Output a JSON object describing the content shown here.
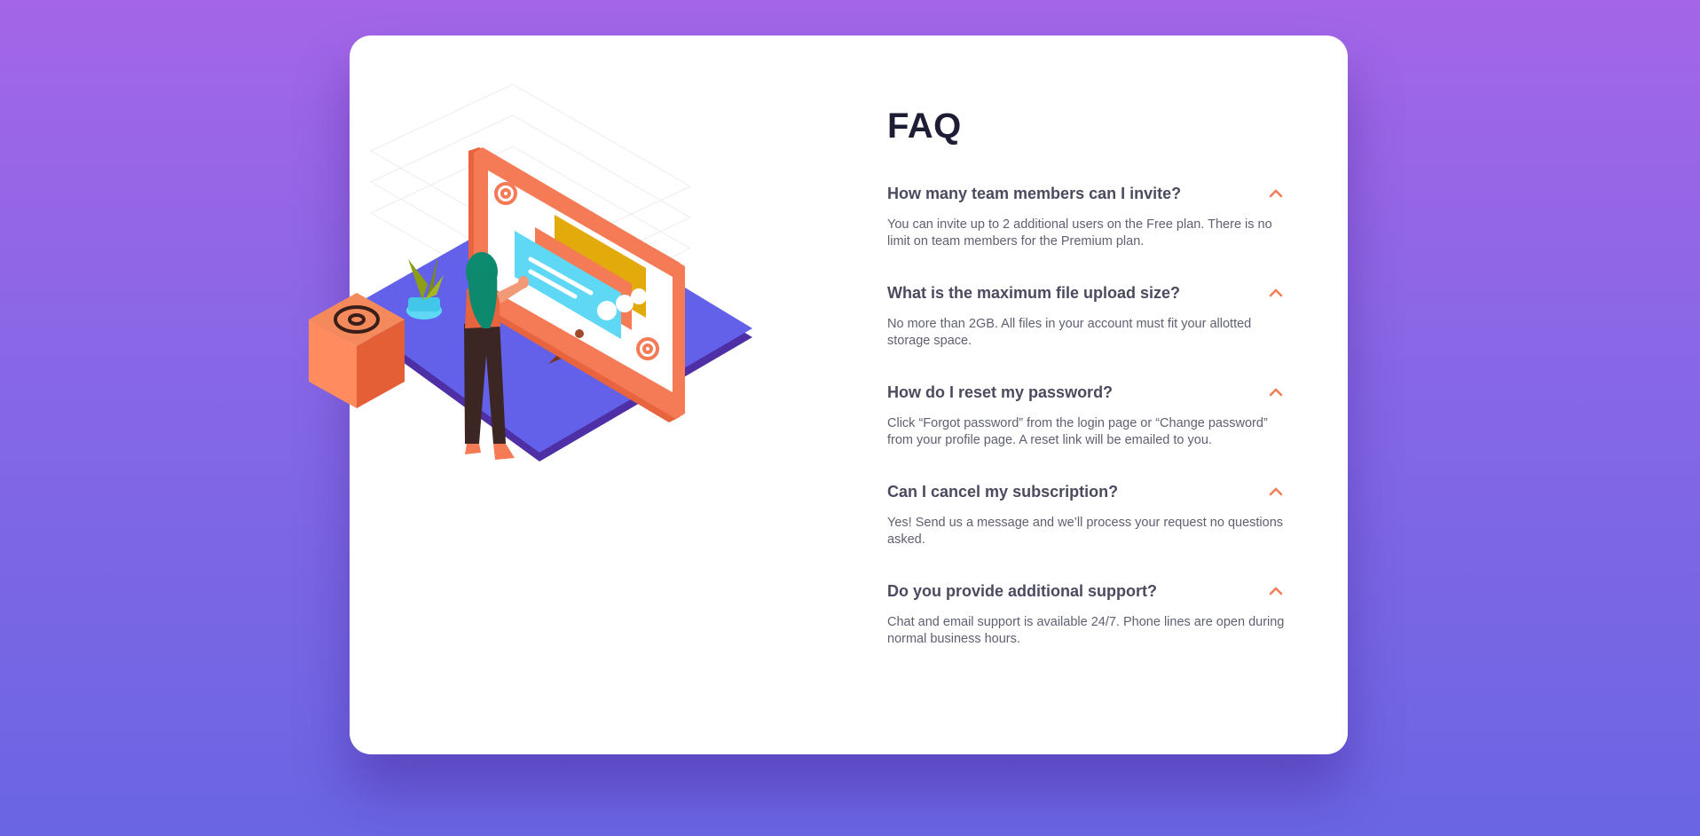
{
  "colors": {
    "background_top": "#a465e8",
    "background_bottom": "#6a65e3",
    "card": "#ffffff",
    "title": "#1d1e35",
    "question": "#4a4b5e",
    "answer": "#5f6071",
    "accent": "#f47b56"
  },
  "faq": {
    "title": "FAQ",
    "items": [
      {
        "question": "How many team members can I invite?",
        "answer": "You can invite up to 2 additional users on the Free plan. There is no limit on team members for the Premium plan.",
        "icon": "chevron-up-icon"
      },
      {
        "question": "What is the maximum file upload size?",
        "answer": "No more than 2GB. All files in your account must fit your allotted storage space.",
        "icon": "chevron-up-icon"
      },
      {
        "question": "How do I reset my password?",
        "answer": "Click “Forgot password” from the login page or “Change password” from your profile page. A reset link will be emailed to you.",
        "icon": "chevron-up-icon"
      },
      {
        "question": "Can I cancel my subscription?",
        "answer": "Yes! Send us a message and we’ll process your request no questions asked.",
        "icon": "chevron-up-icon"
      },
      {
        "question": "Do you provide additional support?",
        "answer": "Chat and email support is available 24/7. Phone lines are open during normal business hours.",
        "icon": "chevron-up-icon"
      }
    ]
  }
}
